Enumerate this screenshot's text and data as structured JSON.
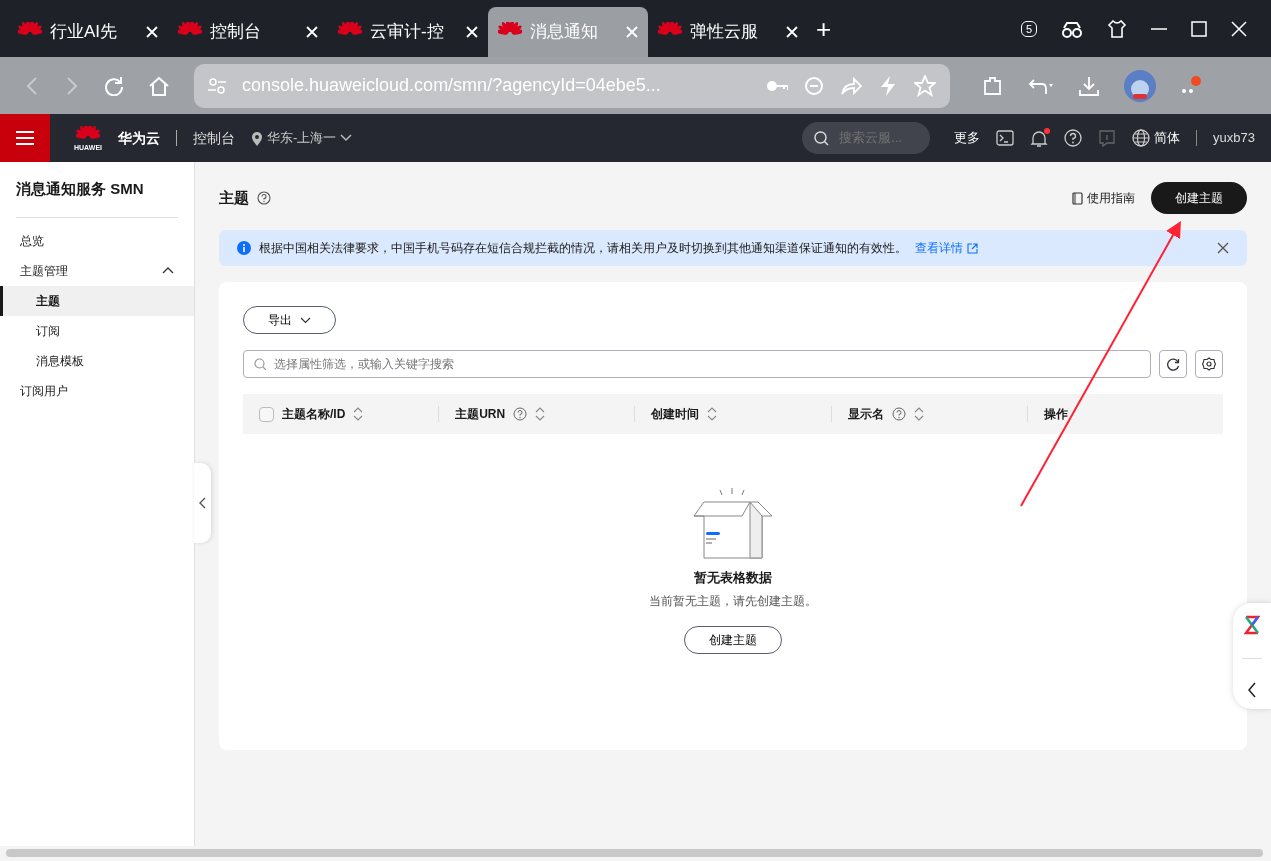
{
  "browser": {
    "tabs": [
      {
        "label": "行业AI先",
        "selected": false
      },
      {
        "label": "控制台",
        "selected": false
      },
      {
        "label": "云审计-控",
        "selected": false
      },
      {
        "label": "消息通知",
        "selected": true
      },
      {
        "label": "弹性云服",
        "selected": false
      }
    ],
    "new_tab": "+",
    "tab_count": "5",
    "url": "console.huaweicloud.com/smn/?agencyId=04ebe5..."
  },
  "console_header": {
    "logo_text": "HUAWEI",
    "brand": "华为云",
    "console": "控制台",
    "region": "华东-上海一",
    "search": {
      "placeholder": "搜索云服..."
    },
    "more": "更多",
    "notifications_unread": true,
    "language": "简体",
    "user": "yuxb73"
  },
  "sidebar": {
    "title": "消息通知服务 SMN",
    "items": [
      {
        "label": "总览",
        "selected": false
      },
      {
        "label": "主题管理",
        "selected": false,
        "expanded": true,
        "children": [
          {
            "label": "主题",
            "selected": true
          },
          {
            "label": "订阅",
            "selected": false
          },
          {
            "label": "消息模板",
            "selected": false
          }
        ]
      },
      {
        "label": "订阅用户",
        "selected": false
      }
    ]
  },
  "page": {
    "title": "主题",
    "guide": "使用指南",
    "create_button": "创建主题"
  },
  "notice": {
    "text": "根据中国相关法律要求，中国手机号码存在短信合规拦截的情况，请相关用户及时切换到其他通知渠道保证通知的有效性。",
    "link": "查看详情"
  },
  "toolbar": {
    "export": "导出",
    "search": {
      "placeholder": "选择属性筛选，或输入关键字搜索"
    }
  },
  "table": {
    "select_all": {
      "checked": false
    },
    "columns": [
      {
        "label": "主题名称/ID",
        "help": false,
        "sortable": true
      },
      {
        "label": "主题URN",
        "help": true,
        "sortable": true
      },
      {
        "label": "创建时间",
        "help": false,
        "sortable": true
      },
      {
        "label": "显示名",
        "help": true,
        "sortable": true
      },
      {
        "label": "操作",
        "help": false,
        "sortable": false
      }
    ]
  },
  "empty_state": {
    "title": "暂无表格数据",
    "text": "当前暂无主题，请先创建主题。",
    "button": "创建主题"
  }
}
